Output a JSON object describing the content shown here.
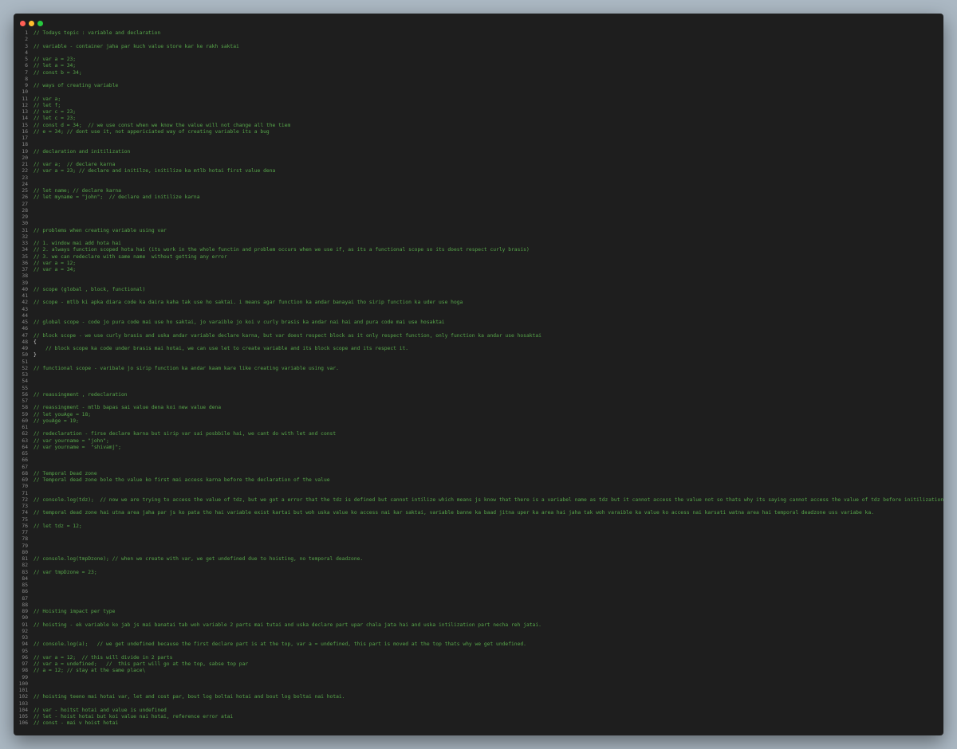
{
  "window": {
    "controls": [
      "close",
      "minimize",
      "maximize"
    ],
    "colors": {
      "close": "#ff5f56",
      "minimize": "#ffbd2e",
      "maximize": "#27c93f",
      "comment": "#57a64a",
      "background": "#1e1e1e"
    }
  },
  "editor": {
    "lines": [
      "// Todays topic : variable and declaration",
      "",
      "// variable - container jaha par kuch value store kar ke rakh saktai",
      "",
      "// var a = 23;",
      "// let a = 34;",
      "// const b = 34;",
      "",
      "// ways of creating variable",
      "",
      "// var a;",
      "// let f;",
      "// var c = 23;",
      "// let c = 23;",
      "// const d = 34;  // we use const when we know the value will not change all the tiem",
      "// e = 34; // dont use it, not appericiated way of creating variable its a bug",
      "",
      "",
      "// declaration and initilization",
      "",
      "// var a;  // declare karna",
      "// var a = 23; // declare and initilze, initilize ka mtlb hotai first value dena",
      "",
      "",
      "// let name; // declare karna",
      "// let myname = \"john\";  // declare and initilize karna",
      "",
      "",
      "",
      "",
      "// problems when creating variable using var",
      "",
      "// 1. window mai add hota hai",
      "// 2. always function scoped hota hai (its work in the whole functin and problem occurs when we use if, as its a functional scope so its doest respect curly brasis)",
      "// 3. we can redeclare with same name  without getting any error",
      "// var a = 12;",
      "// var a = 34;",
      "",
      "",
      "// scope (global , block, functional)",
      "",
      "// scope - mtlb ki apka diara code ka daira kaha tak use ho saktai. i means agar function ka andar banayai tho sirip function ka uder use hoga",
      "",
      "",
      "// global scope - code jo pura code mai use ho saktai, jo varaible jo koi v curly brasis ka andar nai hai and pura code mai use hosaktai",
      "",
      "// block scope - we use curly brasis and uska andar variable declare karna, but var doest respect block as it only respect function, only function ka andar use hosaktai",
      "{",
      "    // block scope ka code under brasis mai hotai, we can use let to create variable and its block scope and its respect it.",
      "}",
      "",
      "// functional scope - varibale jo sirip function ka andar kaam kare like creating variable using var.",
      "",
      "",
      "",
      "// reassingment , redeclaration",
      "",
      "// reassingment - mtlb bapas sai value dena koi new value dena",
      "// let youAge = 18;",
      "// youAge = 19;",
      "",
      "// redeclaration - firse declare karna but sirip var sai posbbile hai, we cant do with let and const",
      "// var yourname = \"john\";",
      "// var yourname =  \"shivamj\";",
      "",
      "",
      "",
      "// Temporal Dead zone",
      "// Temporal dead zone bole tho value ko first mai access karna before the declaration of the value",
      "",
      "",
      "// console.log(tdz);  // now we are trying to access the value of tdz, but we got a error that the tdz is defined but cannot intilize which means js know that there is a variabel name as tdz but it cannot access the value not so thats why its saying cannot access the value of tdz before initilization.   and this the temporal dead  zone",
      "",
      "// temporal dead zone hai utna area jaha par js ko pata tho hai variable exist kartai but woh uska value ko access nai kar saktai, variable banne ka baad jitna uper ka area hai jaha tak woh varaible ka value ko access nai karsati watna area hai temporal deadzone uss variabe ka.",
      "",
      "// let tdz = 12;",
      "",
      "",
      "",
      "",
      "// console.log(tmpDzone); // when we create with var, we get undefined due to hoisting, no temporal deadzone.",
      "",
      "// var tmpDzone = 23;",
      "",
      "",
      "",
      "",
      "",
      "// Hoisting impact per type",
      "",
      "// hoisting - ek variable ko jab js mai banatai tab woh variable 2 parts mai tutai and uska declare part upar chala jata hai and uska intilization part necha reh jatai.",
      "",
      "",
      "// console.log(a);   // we get undefined because the first declare part is at the top, var a = undefined, this part is moved at the top thats why we get undefined.",
      "",
      "// var a = 12;  // this will divide in 2 parts",
      "// var a = undefined;   //  this part will go at the top, sabse top par",
      "// a = 12; // stay at the same place\\",
      "",
      "",
      "",
      "// hoisting teeno mai hotai var, let and cost par, bout log boltai hotai and bout log boltai nai hotai.",
      "",
      "// var - hoitst hotai and value is undefined",
      "// let - hoist hotai but koi value nai hotai, reference error atai",
      "// const - mai v hoist hotai"
    ]
  }
}
